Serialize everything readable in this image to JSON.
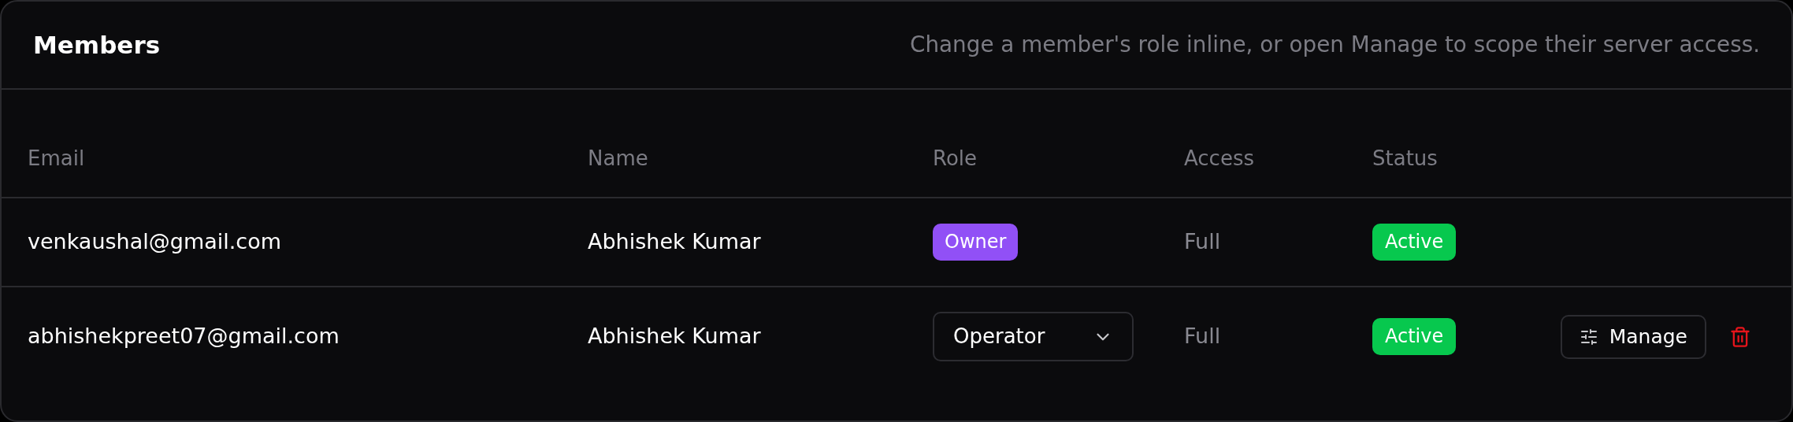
{
  "header": {
    "title": "Members",
    "description": "Change a member's role inline, or open Manage to scope their server access."
  },
  "table": {
    "columns": [
      "Email",
      "Name",
      "Role",
      "Access",
      "Status"
    ],
    "rows": [
      {
        "email": "venkaushal@gmail.com",
        "name": "Abhishek Kumar",
        "role": {
          "kind": "badge",
          "label": "Owner"
        },
        "access": "Full",
        "status": "Active",
        "actions": null
      },
      {
        "email": "abhishekpreet07@gmail.com",
        "name": "Abhishek Kumar",
        "role": {
          "kind": "select",
          "label": "Operator"
        },
        "access": "Full",
        "status": "Active",
        "actions": {
          "manage": "Manage",
          "delete": true
        }
      }
    ]
  }
}
